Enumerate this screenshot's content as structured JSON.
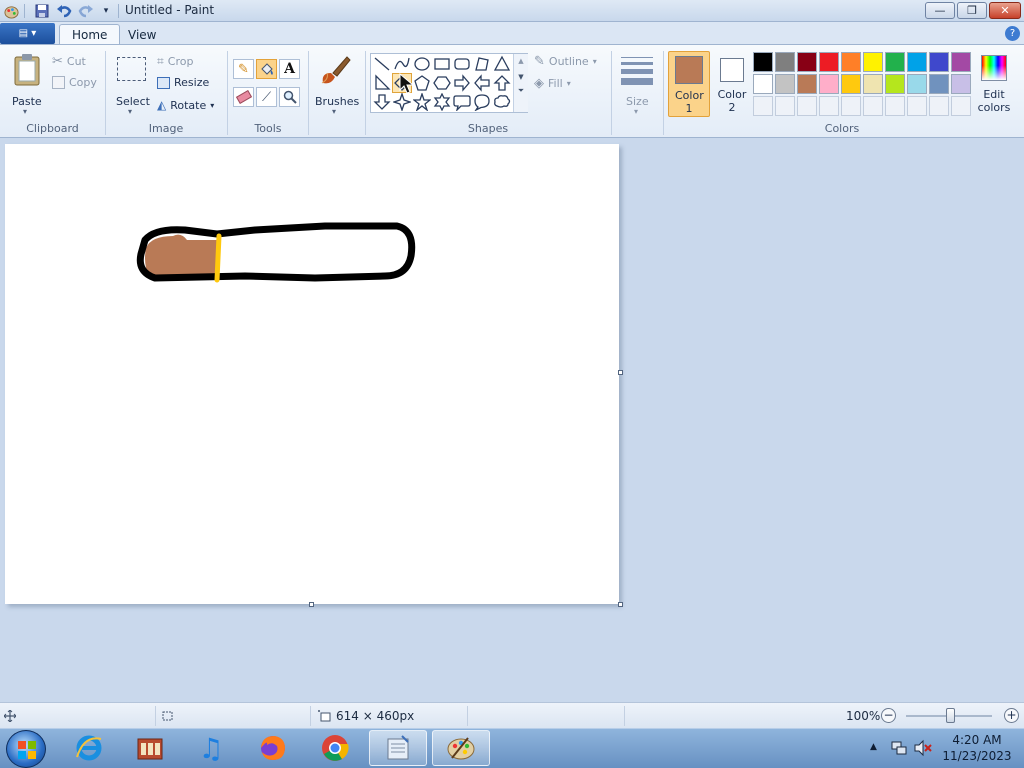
{
  "window": {
    "title": "Untitled - Paint",
    "min_glyph": "—",
    "max_glyph": "❐",
    "close_glyph": "✕"
  },
  "tabs": {
    "file": "▤ ▾",
    "home": "Home",
    "view": "View",
    "help": "?"
  },
  "clipboard": {
    "paste": "Paste",
    "cut": "Cut",
    "copy": "Copy",
    "group": "Clipboard"
  },
  "image": {
    "select": "Select",
    "crop": "Crop",
    "resize": "Resize",
    "rotate": "Rotate",
    "group": "Image"
  },
  "tools": {
    "group": "Tools",
    "text_glyph": "A"
  },
  "brushes": {
    "label": "Brushes"
  },
  "shapes": {
    "outline": "Outline",
    "fill": "Fill",
    "group": "Shapes"
  },
  "size": {
    "label": "Size"
  },
  "colors": {
    "color1": "Color\n1",
    "color2": "Color\n2",
    "color1_value": "#b97a56",
    "color2_value": "#ffffff",
    "edit": "Edit\ncolors",
    "group": "Colors",
    "palette_row1": [
      "#000000",
      "#7f7f7f",
      "#880015",
      "#ed1c24",
      "#ff7f27",
      "#fff200",
      "#22b14c",
      "#00a2e8",
      "#3f48cc",
      "#a349a4"
    ],
    "palette_row2": [
      "#ffffff",
      "#c3c3c3",
      "#b97a57",
      "#ffaec9",
      "#ffc90e",
      "#efe4b0",
      "#b5e61d",
      "#99d9ea",
      "#7092be",
      "#c8bfe7"
    ]
  },
  "status": {
    "dimensions": "614 × 460px",
    "zoom": "100%"
  },
  "clock": {
    "time": "4:20 AM",
    "date": "11/23/2023"
  }
}
